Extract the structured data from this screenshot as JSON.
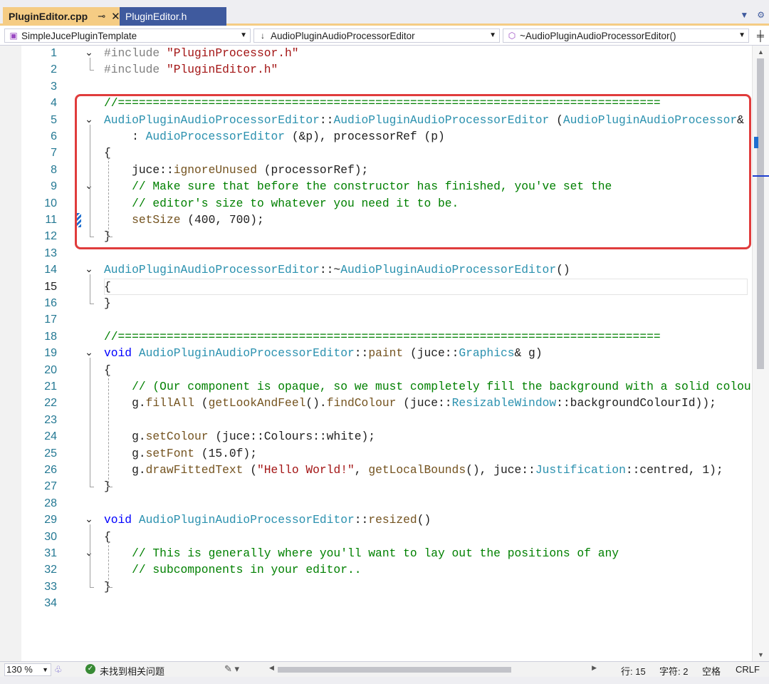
{
  "tabs": {
    "active": {
      "label": "PluginEditor.cpp",
      "pin": "⊸",
      "close": "✕"
    },
    "inactive": {
      "label": "PluginEditor.h"
    }
  },
  "navbar": {
    "project": "SimpleJucePluginTemplate",
    "scope": "AudioPluginAudioProcessorEditor",
    "member": "~AudioPluginAudioProcessorEditor()"
  },
  "code": {
    "current_line": 15,
    "lines": [
      {
        "n": "1",
        "fold": "⌄",
        "tokens": [
          [
            "pp",
            "#include "
          ],
          [
            "str",
            "\"PluginProcessor.h\""
          ]
        ]
      },
      {
        "n": "2",
        "fold": "",
        "tokens": [
          [
            "pp",
            "#include "
          ],
          [
            "str",
            "\"PluginEditor.h\""
          ]
        ]
      },
      {
        "n": "3",
        "fold": "",
        "tokens": []
      },
      {
        "n": "4",
        "fold": "",
        "tokens": [
          [
            "cm",
            "//=============================================================================="
          ]
        ]
      },
      {
        "n": "5",
        "fold": "⌄",
        "tokens": [
          [
            "cls",
            "AudioPluginAudioProcessorEditor"
          ],
          [
            "pl",
            "::"
          ],
          [
            "cls",
            "AudioPluginAudioProcessorEditor"
          ],
          [
            "pl",
            " ("
          ],
          [
            "cls",
            "AudioPluginAudioProcessor"
          ],
          [
            "pl",
            "& p)"
          ]
        ]
      },
      {
        "n": "6",
        "fold": "",
        "tokens": [
          [
            "pl",
            "    : "
          ],
          [
            "cls",
            "AudioProcessorEditor"
          ],
          [
            "pl",
            " (&p), processorRef (p)"
          ]
        ]
      },
      {
        "n": "7",
        "fold": "",
        "tokens": [
          [
            "pl",
            "{"
          ]
        ]
      },
      {
        "n": "8",
        "fold": "",
        "tokens": [
          [
            "pl",
            "    "
          ],
          [
            "pl",
            "juce::"
          ],
          [
            "fn",
            "ignoreUnused"
          ],
          [
            "pl",
            " (processorRef);"
          ]
        ]
      },
      {
        "n": "9",
        "fold": "⌄",
        "tokens": [
          [
            "pl",
            "    "
          ],
          [
            "cm",
            "// Make sure that before the constructor has finished, you've set the"
          ]
        ]
      },
      {
        "n": "10",
        "fold": "",
        "tokens": [
          [
            "pl",
            "    "
          ],
          [
            "cm",
            "// editor's size to whatever you need it to be."
          ]
        ]
      },
      {
        "n": "11",
        "fold": "",
        "tokens": [
          [
            "pl",
            "    "
          ],
          [
            "fn",
            "setSize"
          ],
          [
            "pl",
            " (400, 700);"
          ]
        ]
      },
      {
        "n": "12",
        "fold": "",
        "tokens": [
          [
            "pl",
            "}"
          ]
        ]
      },
      {
        "n": "13",
        "fold": "",
        "tokens": []
      },
      {
        "n": "14",
        "fold": "⌄",
        "tokens": [
          [
            "cls",
            "AudioPluginAudioProcessorEditor"
          ],
          [
            "pl",
            "::~"
          ],
          [
            "cls",
            "AudioPluginAudioProcessorEditor"
          ],
          [
            "pl",
            "()"
          ]
        ]
      },
      {
        "n": "15",
        "fold": "",
        "tokens": [
          [
            "pl",
            "{"
          ]
        ]
      },
      {
        "n": "16",
        "fold": "",
        "tokens": [
          [
            "pl",
            "}"
          ]
        ]
      },
      {
        "n": "17",
        "fold": "",
        "tokens": []
      },
      {
        "n": "18",
        "fold": "",
        "tokens": [
          [
            "cm",
            "//=============================================================================="
          ]
        ]
      },
      {
        "n": "19",
        "fold": "⌄",
        "tokens": [
          [
            "kw",
            "void"
          ],
          [
            "pl",
            " "
          ],
          [
            "cls",
            "AudioPluginAudioProcessorEditor"
          ],
          [
            "pl",
            "::"
          ],
          [
            "fn",
            "paint"
          ],
          [
            "pl",
            " (juce::"
          ],
          [
            "cls",
            "Graphics"
          ],
          [
            "pl",
            "& g)"
          ]
        ]
      },
      {
        "n": "20",
        "fold": "",
        "tokens": [
          [
            "pl",
            "{"
          ]
        ]
      },
      {
        "n": "21",
        "fold": "",
        "tokens": [
          [
            "pl",
            "    "
          ],
          [
            "cm",
            "// (Our component is opaque, so we must completely fill the background with a solid colour)"
          ]
        ]
      },
      {
        "n": "22",
        "fold": "",
        "tokens": [
          [
            "pl",
            "    g."
          ],
          [
            "fn",
            "fillAll"
          ],
          [
            "pl",
            " ("
          ],
          [
            "fn",
            "getLookAndFeel"
          ],
          [
            "pl",
            "()."
          ],
          [
            "fn",
            "findColour"
          ],
          [
            "pl",
            " (juce::"
          ],
          [
            "cls",
            "ResizableWindow"
          ],
          [
            "pl",
            "::backgroundColourId));"
          ]
        ]
      },
      {
        "n": "23",
        "fold": "",
        "tokens": []
      },
      {
        "n": "24",
        "fold": "",
        "tokens": [
          [
            "pl",
            "    g."
          ],
          [
            "fn",
            "setColour"
          ],
          [
            "pl",
            " (juce::Colours::white);"
          ]
        ]
      },
      {
        "n": "25",
        "fold": "",
        "tokens": [
          [
            "pl",
            "    g."
          ],
          [
            "fn",
            "setFont"
          ],
          [
            "pl",
            " (15.0f);"
          ]
        ]
      },
      {
        "n": "26",
        "fold": "",
        "tokens": [
          [
            "pl",
            "    g."
          ],
          [
            "fn",
            "drawFittedText"
          ],
          [
            "pl",
            " ("
          ],
          [
            "str",
            "\"Hello World!\""
          ],
          [
            "pl",
            ", "
          ],
          [
            "fn",
            "getLocalBounds"
          ],
          [
            "pl",
            "(), juce::"
          ],
          [
            "cls",
            "Justification"
          ],
          [
            "pl",
            "::centred, 1);"
          ]
        ]
      },
      {
        "n": "27",
        "fold": "",
        "tokens": [
          [
            "pl",
            "}"
          ]
        ]
      },
      {
        "n": "28",
        "fold": "",
        "tokens": []
      },
      {
        "n": "29",
        "fold": "⌄",
        "tokens": [
          [
            "kw",
            "void"
          ],
          [
            "pl",
            " "
          ],
          [
            "cls",
            "AudioPluginAudioProcessorEditor"
          ],
          [
            "pl",
            "::"
          ],
          [
            "fn",
            "resized"
          ],
          [
            "pl",
            "()"
          ]
        ]
      },
      {
        "n": "30",
        "fold": "",
        "tokens": [
          [
            "pl",
            "{"
          ]
        ]
      },
      {
        "n": "31",
        "fold": "⌄",
        "tokens": [
          [
            "pl",
            "    "
          ],
          [
            "cm",
            "// This is generally where you'll want to lay out the positions of any"
          ]
        ]
      },
      {
        "n": "32",
        "fold": "",
        "tokens": [
          [
            "pl",
            "    "
          ],
          [
            "cm",
            "// subcomponents in your editor.."
          ]
        ]
      },
      {
        "n": "33",
        "fold": "",
        "tokens": [
          [
            "pl",
            "}"
          ]
        ]
      },
      {
        "n": "34",
        "fold": "",
        "tokens": []
      }
    ]
  },
  "statusbar": {
    "zoom": "130 %",
    "issues": "未找到相关问题",
    "row": "行: 15",
    "col": "字符: 2",
    "spaces": "空格",
    "eol": "CRLF"
  },
  "colors": {
    "tab_active": "#f5cc84",
    "tab_inactive": "#3f5a9e",
    "highlight_box": "#e03c3c"
  }
}
